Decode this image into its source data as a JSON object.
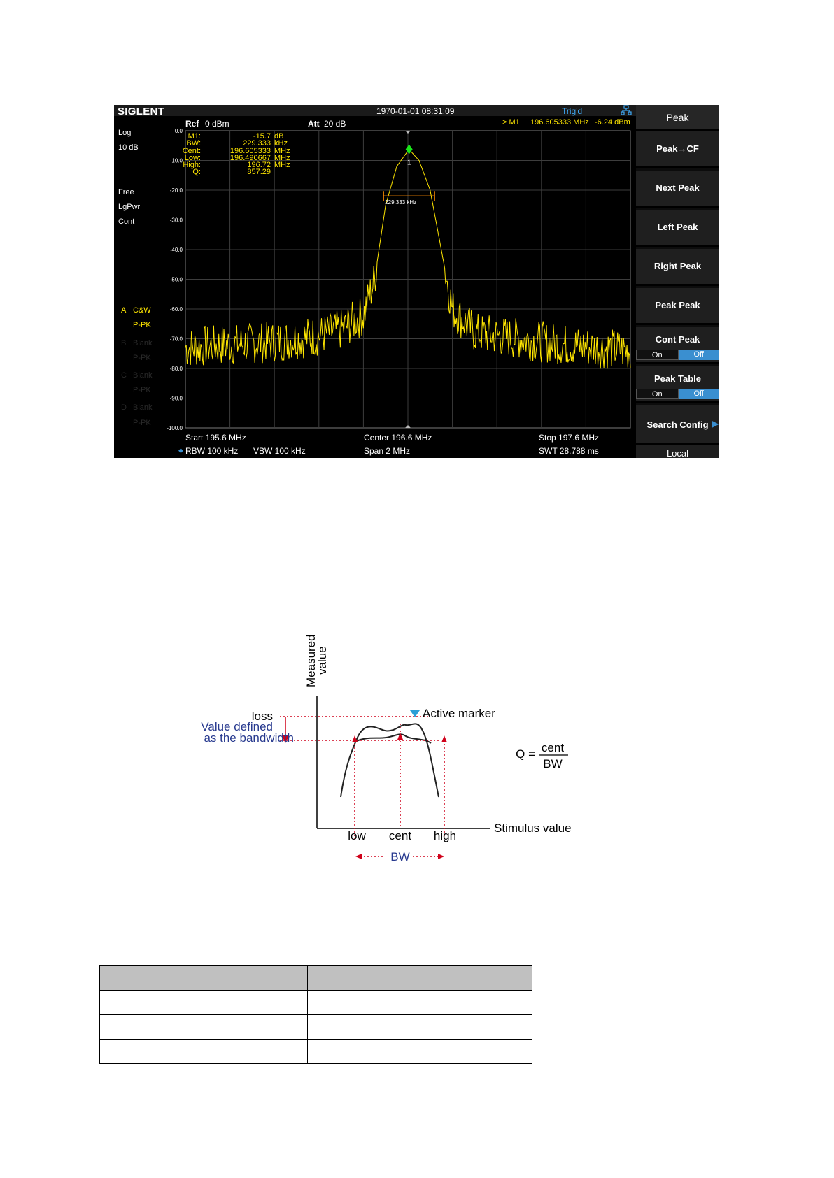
{
  "screen": {
    "logo": "SIGLENT",
    "datetime": "1970-01-01 08:31:09",
    "trig": "Trig'd",
    "ref_label": "Ref",
    "ref_value": "0 dBm",
    "att_label": "Att",
    "att_value": "20 dB",
    "marker_readout": {
      "prefix": "> M1",
      "freq": "196.605333 MHz",
      "level": "-6.24 dBm"
    },
    "left_panel": {
      "scale_type": "Log",
      "scale_div": "10 dB",
      "trig_mode": "Free",
      "det": "LgPwr",
      "sweep": "Cont",
      "traces": [
        {
          "letter": "A",
          "mode": "C&W",
          "det": "P-PK",
          "active": true
        },
        {
          "letter": "B",
          "mode": "Blank",
          "det": "P-PK",
          "active": false
        },
        {
          "letter": "C",
          "mode": "Blank",
          "det": "P-PK",
          "active": false
        },
        {
          "letter": "D",
          "mode": "Blank",
          "det": "P-PK",
          "active": false
        }
      ]
    },
    "nbw_table": [
      {
        "label": "M1:",
        "value": "-15.7",
        "unit": "dB"
      },
      {
        "label": "BW:",
        "value": "229.333",
        "unit": "kHz"
      },
      {
        "label": "Cent:",
        "value": "196.605333",
        "unit": "MHz"
      },
      {
        "label": "Low:",
        "value": "196.490667",
        "unit": "MHz"
      },
      {
        "label": "High:",
        "value": "196.72",
        "unit": "MHz"
      },
      {
        "label": "Q:",
        "value": "857.29",
        "unit": ""
      }
    ],
    "bw_annotation": "229.333 kHz",
    "marker_number": "1",
    "bottom": {
      "start": "Start  195.6 MHz",
      "center": "Center  196.6 MHz",
      "stop": "Stop  197.6 MHz",
      "rbw": "RBW  100 kHz",
      "vbw": "VBW  100 kHz",
      "span": "Span    2 MHz",
      "swt": "SWT  28.788 ms"
    },
    "softkeys": {
      "title": "Peak",
      "peak_cf": "Peak→CF",
      "next_peak": "Next Peak",
      "left_peak": "Left Peak",
      "right_peak": "Right Peak",
      "peak_peak": "Peak Peak",
      "cont_peak": "Cont Peak",
      "peak_table": "Peak Table",
      "on": "On",
      "off": "Off",
      "search_config": "Search Config",
      "local": "Local"
    },
    "colors": {
      "trace": "#ffe600",
      "marker": "#19e619",
      "bw_line": "#ff8c00",
      "accent": "#3a8fd0"
    }
  },
  "chart_data": {
    "type": "line",
    "title": "",
    "xlabel": "",
    "ylabel": "",
    "xlim": [
      195.6,
      197.6
    ],
    "ylim": [
      -100,
      0
    ],
    "y_ticks": [
      "0.0",
      "-10.0",
      "-20.0",
      "-30.0",
      "-40.0",
      "-50.0",
      "-60.0",
      "-70.0",
      "-80.0",
      "-90.0",
      "-100.0"
    ],
    "grid": true,
    "series": [
      {
        "x": [
          195.6,
          195.8,
          196.0,
          196.2,
          196.3,
          196.4,
          196.45,
          196.5,
          196.55,
          196.605,
          196.65,
          196.7,
          196.75,
          196.8,
          196.85,
          196.9,
          197.1,
          197.3,
          197.6
        ],
        "y": [
          -73,
          -72,
          -71,
          -69,
          -67,
          -62,
          -50,
          -25,
          -12,
          -6.24,
          -10,
          -20,
          -40,
          -60,
          -64,
          -68,
          -70,
          -72,
          -74
        ]
      }
    ],
    "marker": {
      "x": 196.605333,
      "y": -6.24
    }
  },
  "diagram": {
    "y_axis_label_1": "Measured",
    "y_axis_label_2": "value",
    "x_axis_label": "Stimulus value",
    "loss": "loss",
    "value_defined_1": "Value defined",
    "value_defined_2": "as the bandwidth",
    "active_marker": "Active marker",
    "low": "low",
    "cent": "cent",
    "high": "high",
    "bw": "BW",
    "q_lhs": "Q =",
    "q_num": "cent",
    "q_den": "BW"
  },
  "table": {
    "header": [
      "",
      ""
    ],
    "rows": [
      [
        "",
        ""
      ],
      [
        "",
        ""
      ],
      [
        "",
        ""
      ]
    ]
  }
}
